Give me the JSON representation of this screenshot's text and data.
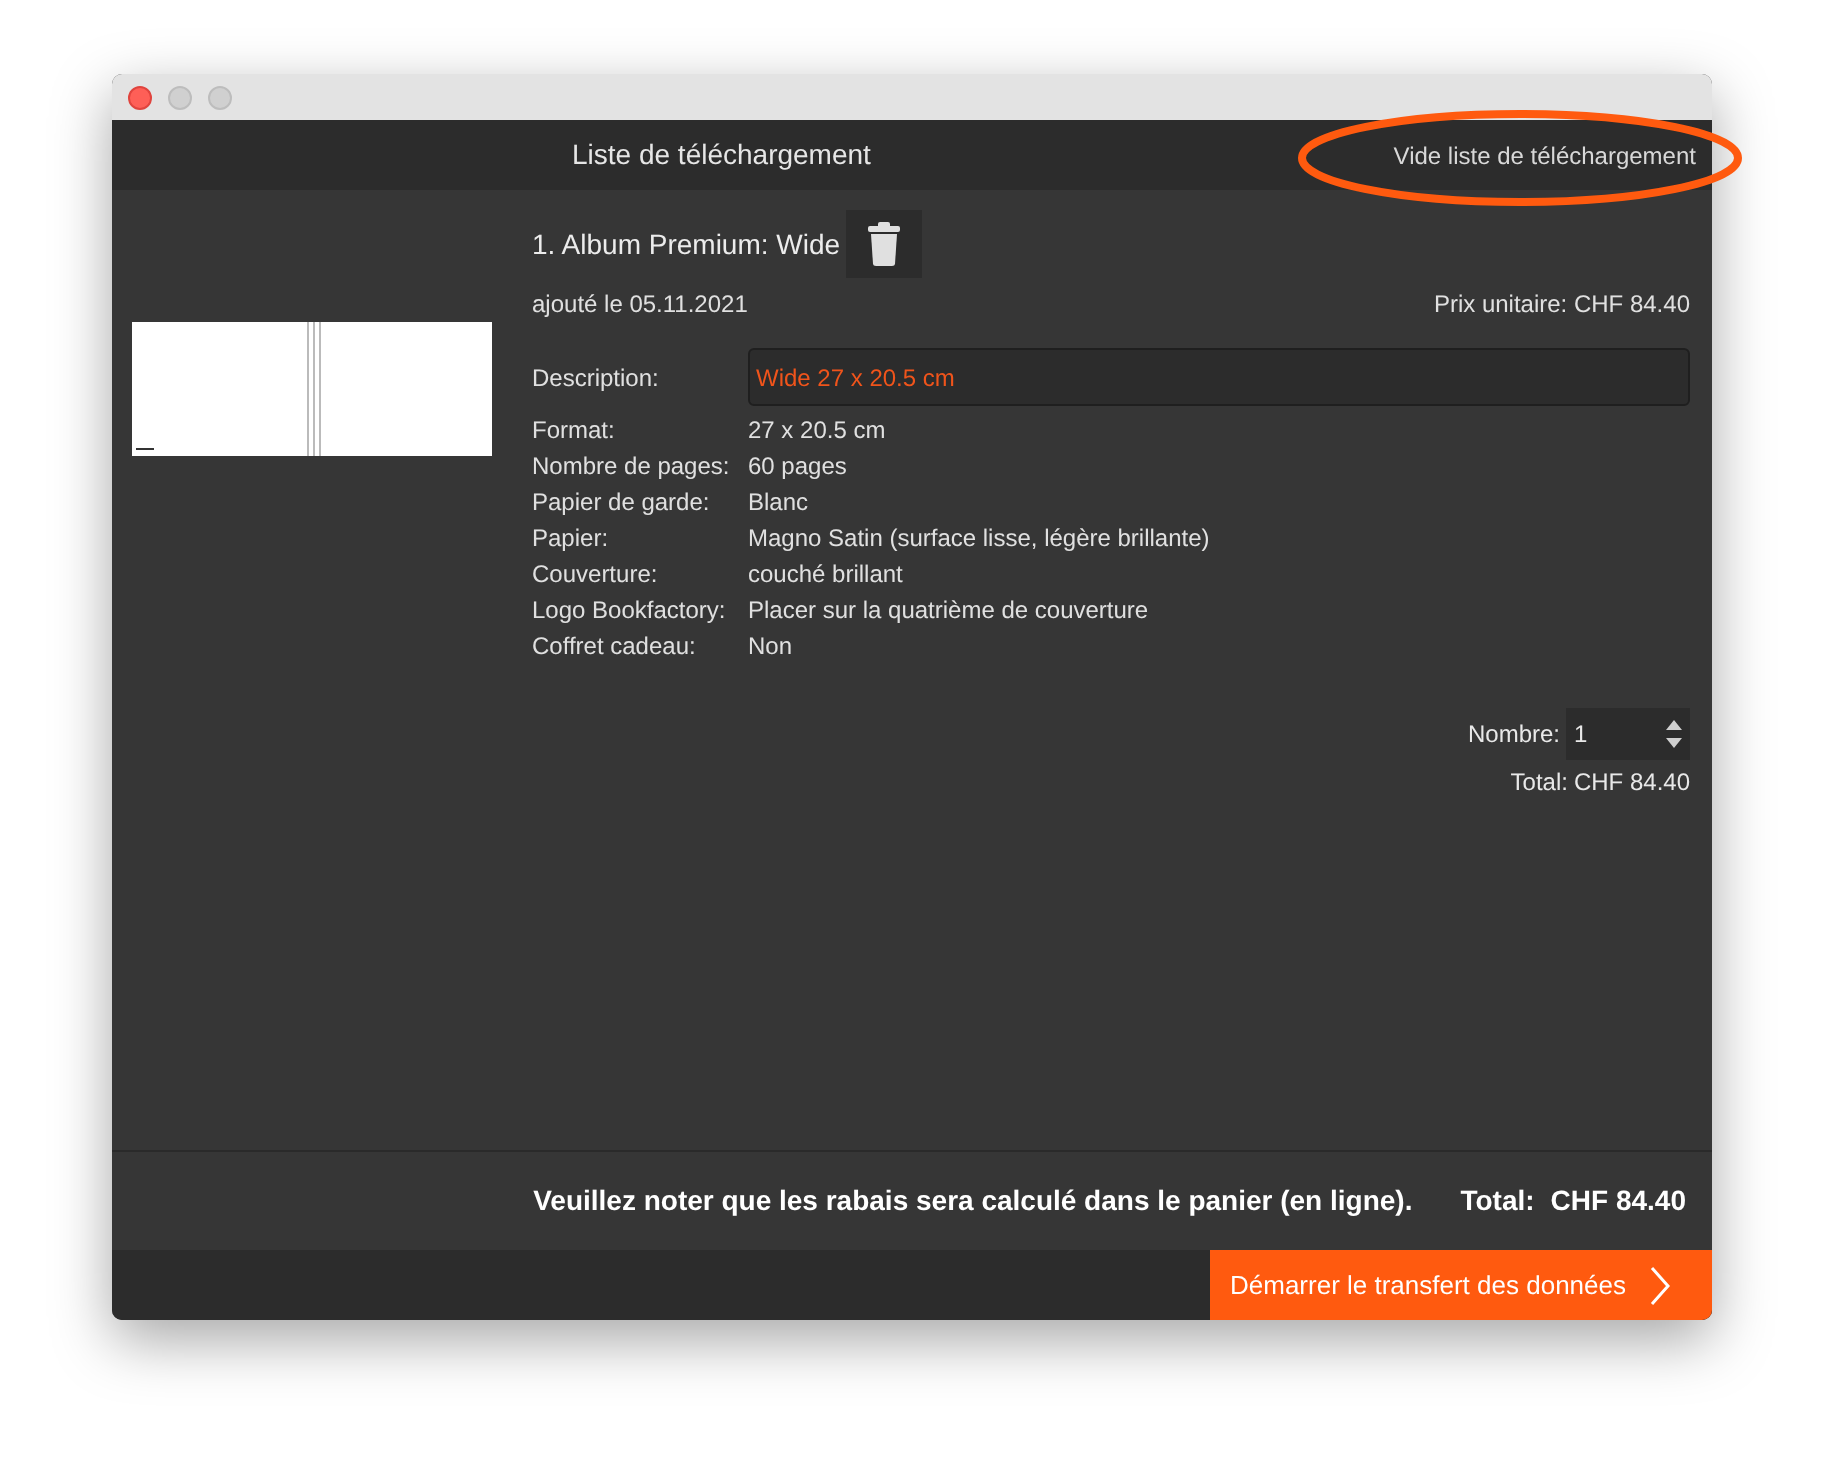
{
  "header": {
    "title": "Liste de téléchargement",
    "clear_button": "Vide liste de téléchargement"
  },
  "item": {
    "title": "1. Album Premium: Wide",
    "added": "ajouté le 05.11.2021",
    "unit_price": "Prix unitaire: CHF 84.40",
    "description": {
      "label": "Description:",
      "value": "Wide 27 x 20.5 cm"
    },
    "specs": [
      {
        "label": "Format:",
        "value": "27 x 20.5 cm"
      },
      {
        "label": "Nombre de pages:",
        "value": "60 pages"
      },
      {
        "label": "Papier de garde:",
        "value": "Blanc"
      },
      {
        "label": "Papier:",
        "value": "Magno Satin (surface lisse, légère brillante)"
      },
      {
        "label": "Couverture:",
        "value": "couché brillant"
      },
      {
        "label": "Logo Bookfactory:",
        "value": "Placer sur la quatrième de couverture"
      },
      {
        "label": "Coffret cadeau:",
        "value": "Non"
      }
    ],
    "quantity": {
      "label": "Nombre:",
      "value": "1"
    },
    "total": {
      "label": "Total:",
      "value": "CHF 84.40"
    }
  },
  "footer": {
    "note": "Veuillez noter que les rabais sera calculé dans le panier (en ligne).",
    "total_label": "Total:",
    "total_value": "CHF 84.40"
  },
  "start_button": "Démarrer le transfert des données"
}
